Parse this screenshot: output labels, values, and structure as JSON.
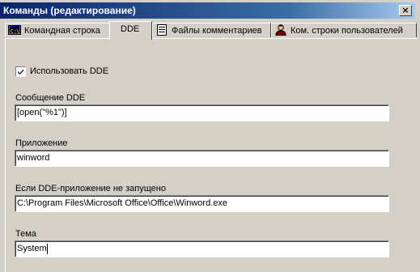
{
  "window": {
    "title": "Команды (редактирование)",
    "close_glyph": "×"
  },
  "tabs": [
    {
      "label": "Командная строка",
      "icon": "command-prompt-icon",
      "active": false
    },
    {
      "label": "DDE",
      "icon": "",
      "active": true
    },
    {
      "label": "Файлы комментариев",
      "icon": "document-icon",
      "active": false
    },
    {
      "label": "Ком. строки пользователей",
      "icon": "user-icon",
      "active": false
    }
  ],
  "dde": {
    "use_dde": {
      "label": "Использовать DDE",
      "checked": true
    },
    "message": {
      "label": "Сообщение DDE",
      "value": "[open(\"%1\")]"
    },
    "application": {
      "label": "Приложение",
      "value": "winword"
    },
    "if_not_running": {
      "label": "Если DDE-приложение не запущено",
      "value": "C:\\Program Files\\Microsoft Office\\Office\\Winword.exe"
    },
    "topic": {
      "label": "Тема",
      "value": "System"
    }
  }
}
